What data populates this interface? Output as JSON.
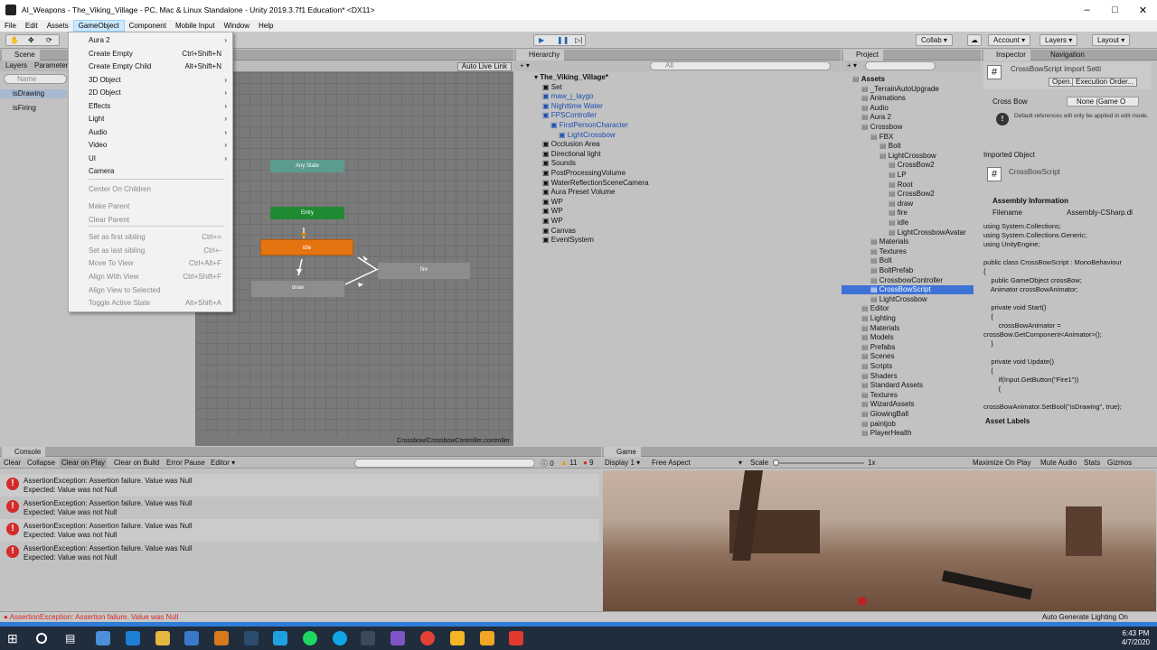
{
  "window": {
    "title": "AI_Weapons - The_Viking_Village - PC, Mac & Linux Standalone - Unity 2019.3.7f1 Education* <DX11>"
  },
  "menu": [
    "File",
    "Edit",
    "Assets",
    "GameObject",
    "Component",
    "Mobile Input",
    "Window",
    "Help"
  ],
  "toolbar": {
    "collab": "Collab",
    "account": "Account",
    "layers": "Layers",
    "layout": "Layout"
  },
  "left_tabs": {
    "scene": "Scene",
    "layers": "Layers",
    "parameters": "Parameters",
    "name_placeholder": "Name",
    "params": [
      "isDrawing",
      "isFiring"
    ]
  },
  "animator": {
    "live_link": "Auto Live Link",
    "path": "Crossbow/CrossbowController.controller",
    "nodes": {
      "any_state": "Any State",
      "entry": "Entry",
      "idle": "idle",
      "fire": "fire",
      "draw": "draw"
    }
  },
  "dropdown": {
    "items": [
      {
        "label": "Aura 2",
        "shortcut": "",
        "sub": true,
        "disabled": false
      },
      {
        "label": "Create Empty",
        "shortcut": "Ctrl+Shift+N",
        "sub": false,
        "disabled": false
      },
      {
        "label": "Create Empty Child",
        "shortcut": "Alt+Shift+N",
        "sub": false,
        "disabled": false
      },
      {
        "label": "3D Object",
        "shortcut": "",
        "sub": true,
        "disabled": false
      },
      {
        "label": "2D Object",
        "shortcut": "",
        "sub": true,
        "disabled": false
      },
      {
        "label": "Effects",
        "shortcut": "",
        "sub": true,
        "disabled": false
      },
      {
        "label": "Light",
        "shortcut": "",
        "sub": true,
        "disabled": false
      },
      {
        "label": "Audio",
        "shortcut": "",
        "sub": true,
        "disabled": false
      },
      {
        "label": "Video",
        "shortcut": "",
        "sub": true,
        "disabled": false
      },
      {
        "label": "UI",
        "shortcut": "",
        "sub": true,
        "disabled": false
      },
      {
        "label": "Camera",
        "shortcut": "",
        "sub": false,
        "disabled": false
      },
      {
        "label": "Center On Children",
        "shortcut": "",
        "sub": false,
        "disabled": true
      },
      {
        "label": "Make Parent",
        "shortcut": "",
        "sub": false,
        "disabled": true
      },
      {
        "label": "Clear Parent",
        "shortcut": "",
        "sub": false,
        "disabled": true
      },
      {
        "label": "Set as first sibling",
        "shortcut": "Ctrl+=",
        "sub": false,
        "disabled": true
      },
      {
        "label": "Set as last sibling",
        "shortcut": "Ctrl+-",
        "sub": false,
        "disabled": true
      },
      {
        "label": "Move To View",
        "shortcut": "Ctrl+Alt+F",
        "sub": false,
        "disabled": true
      },
      {
        "label": "Align With View",
        "shortcut": "Ctrl+Shift+F",
        "sub": false,
        "disabled": true
      },
      {
        "label": "Align View to Selected",
        "shortcut": "",
        "sub": false,
        "disabled": true
      },
      {
        "label": "Toggle Active State",
        "shortcut": "Alt+Shift+A",
        "sub": false,
        "disabled": true
      }
    ]
  },
  "hierarchy": {
    "tab": "Hierarchy",
    "search_placeholder": "All",
    "items": [
      {
        "label": "The_Viking_Village*",
        "indent": 0,
        "blue": false
      },
      {
        "label": "Set",
        "indent": 1,
        "blue": false
      },
      {
        "label": "maw_j_laygo",
        "indent": 1,
        "blue": true
      },
      {
        "label": "Nighttime Water",
        "indent": 1,
        "blue": true
      },
      {
        "label": "FPSController",
        "indent": 1,
        "blue": true
      },
      {
        "label": "FirstPersonCharacter",
        "indent": 2,
        "blue": true
      },
      {
        "label": "LightCrossbow",
        "indent": 3,
        "blue": true
      },
      {
        "label": "Occlusion Area",
        "indent": 1,
        "blue": false
      },
      {
        "label": "Directional light",
        "indent": 1,
        "blue": false
      },
      {
        "label": "Sounds",
        "indent": 1,
        "blue": false
      },
      {
        "label": "PostProcessingVolume",
        "indent": 1,
        "blue": false
      },
      {
        "label": "WaterReflectionSceneCamera",
        "indent": 1,
        "blue": false
      },
      {
        "label": "Aura Preset Volume",
        "indent": 1,
        "blue": false
      },
      {
        "label": "WP",
        "indent": 1,
        "blue": false
      },
      {
        "label": "WP",
        "indent": 1,
        "blue": false
      },
      {
        "label": "WP",
        "indent": 1,
        "blue": false
      },
      {
        "label": "Canvas",
        "indent": 1,
        "blue": false
      },
      {
        "label": "EventSystem",
        "indent": 1,
        "blue": false
      }
    ]
  },
  "project": {
    "tab": "Project",
    "items": [
      {
        "label": "Assets",
        "indent": 0,
        "sel": false
      },
      {
        "label": "_TerrainAutoUpgrade",
        "indent": 1,
        "sel": false
      },
      {
        "label": "Animations",
        "indent": 1,
        "sel": false
      },
      {
        "label": "Audio",
        "indent": 1,
        "sel": false
      },
      {
        "label": "Aura 2",
        "indent": 1,
        "sel": false
      },
      {
        "label": "Crossbow",
        "indent": 1,
        "sel": false
      },
      {
        "label": "FBX",
        "indent": 2,
        "sel": false
      },
      {
        "label": "Bolt",
        "indent": 3,
        "sel": false
      },
      {
        "label": "LightCrossbow",
        "indent": 3,
        "sel": false
      },
      {
        "label": "CrossBow2",
        "indent": 4,
        "sel": false
      },
      {
        "label": "LP",
        "indent": 4,
        "sel": false
      },
      {
        "label": "Root",
        "indent": 4,
        "sel": false
      },
      {
        "label": "CrossBow2",
        "indent": 4,
        "sel": false
      },
      {
        "label": "draw",
        "indent": 4,
        "sel": false
      },
      {
        "label": "fire",
        "indent": 4,
        "sel": false
      },
      {
        "label": "idle",
        "indent": 4,
        "sel": false
      },
      {
        "label": "LightCrossbowAvatar",
        "indent": 4,
        "sel": false
      },
      {
        "label": "Materials",
        "indent": 2,
        "sel": false
      },
      {
        "label": "Textures",
        "indent": 2,
        "sel": false
      },
      {
        "label": "Bolt",
        "indent": 2,
        "sel": false
      },
      {
        "label": "BoltPrefab",
        "indent": 2,
        "sel": false
      },
      {
        "label": "CrossbowController",
        "indent": 2,
        "sel": false
      },
      {
        "label": "CrossBowScript",
        "indent": 2,
        "sel": true
      },
      {
        "label": "LightCrossbow",
        "indent": 2,
        "sel": false
      },
      {
        "label": "Editor",
        "indent": 1,
        "sel": false
      },
      {
        "label": "Lighting",
        "indent": 1,
        "sel": false
      },
      {
        "label": "Materials",
        "indent": 1,
        "sel": false
      },
      {
        "label": "Models",
        "indent": 1,
        "sel": false
      },
      {
        "label": "Prefabs",
        "indent": 1,
        "sel": false
      },
      {
        "label": "Scenes",
        "indent": 1,
        "sel": false
      },
      {
        "label": "Scripts",
        "indent": 1,
        "sel": false
      },
      {
        "label": "Shaders",
        "indent": 1,
        "sel": false
      },
      {
        "label": "Standard Assets",
        "indent": 1,
        "sel": false
      },
      {
        "label": "Textures",
        "indent": 1,
        "sel": false
      },
      {
        "label": "WizardAssets",
        "indent": 1,
        "sel": false
      },
      {
        "label": "GlowingBall",
        "indent": 1,
        "sel": false
      },
      {
        "label": "paintjob",
        "indent": 1,
        "sel": false
      },
      {
        "label": "PlayerHealth",
        "indent": 1,
        "sel": false
      }
    ]
  },
  "inspector": {
    "tab": "Inspector",
    "nav_tab": "Navigation",
    "header": "CrossBowScript Import Setti",
    "open": "Open...",
    "exec": "Execution Order...",
    "field_label": "Cross Bow",
    "field_value": "None (Game O",
    "info": "Default references will only be applied in edit mode.",
    "imported": "Imported Object",
    "imported_name": "CrossBowScript",
    "assembly": "Assembly Information",
    "filename_label": "Filename",
    "filename_value": "Assembly-CSharp.dl",
    "code": "using System.Collections;\nusing System.Collections.Generic;\nusing UnityEngine;\n\npublic class CrossBowScript : MonoBehaviour\n{\n    public GameObject crossBow;\n    Animator crossBowAnimator;\n\n    private void Start()\n    {\n        crossBowAnimator =\ncrossBow.GetComponent<Animator>();\n    }\n\n    private void Update()\n    {\n        if(Input.GetButton(\"Fire1\"))\n        {\n\ncrossBowAnimator.SetBool(\"isDrawing\", true);",
    "asset_labels": "Asset Labels"
  },
  "console": {
    "tab": "Console",
    "buttons": [
      "Clear",
      "Collapse",
      "Clear on Play",
      "Clear on Build",
      "Error Pause",
      "Editor"
    ],
    "counts": {
      "info": "0",
      "warn": "11",
      "err": "9"
    },
    "line1": "AssertionException: Assertion failure. Value was Null",
    "line2": "Expected: Value was not Null",
    "status": "AssertionException: Assertion failure. Value was Null"
  },
  "game": {
    "tab": "Game",
    "display": "Display 1",
    "aspect": "Free Aspect",
    "scale": "Scale",
    "scale_val": "1x",
    "max": "Maximize On Play",
    "mute": "Mute Audio",
    "stats": "Stats",
    "gizmos": "Gizmos"
  },
  "status_right": "Auto Generate Lighting On",
  "clock": {
    "time": "6:43 PM",
    "date": "4/7/2020"
  }
}
